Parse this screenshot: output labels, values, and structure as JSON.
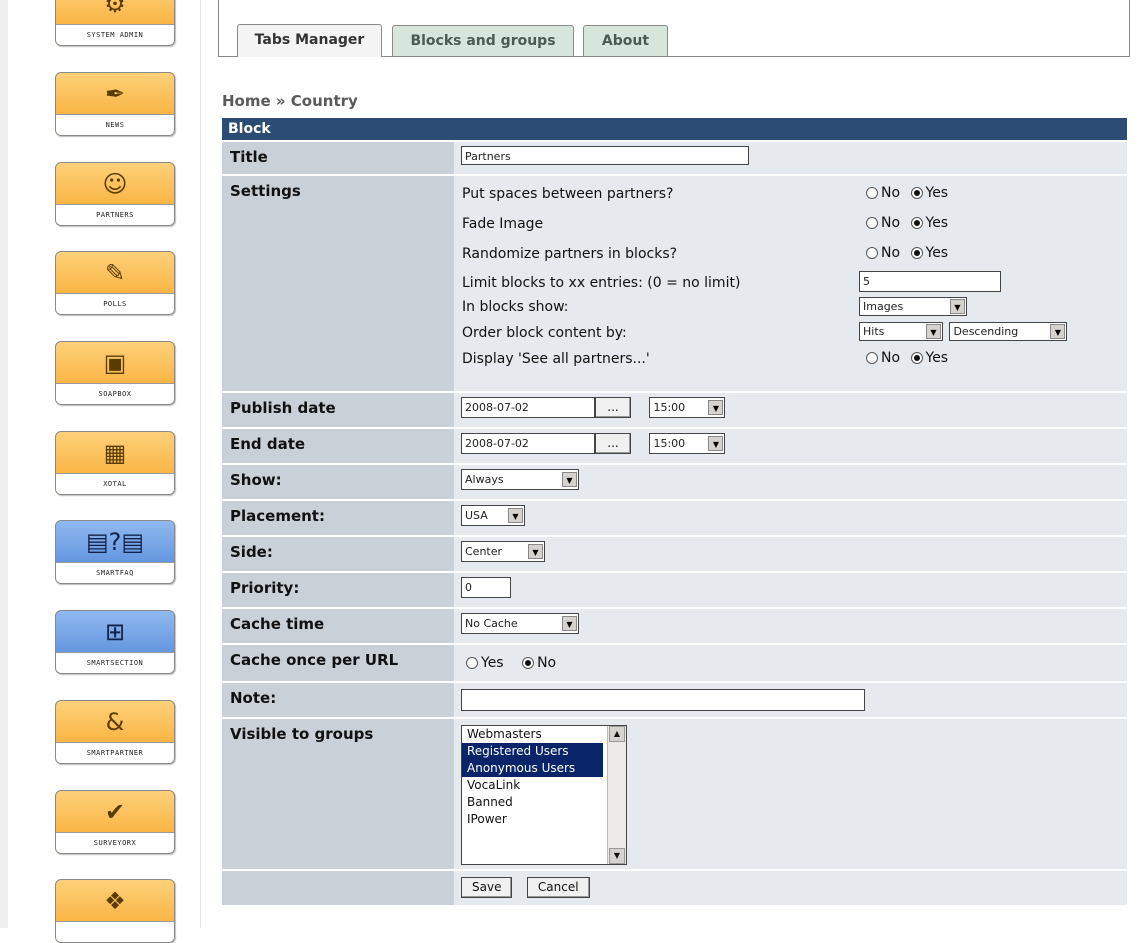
{
  "sidebar": {
    "modules": [
      {
        "label": "SYSTEM ADMIN",
        "icon": "system-admin-icon"
      },
      {
        "label": "NEWS",
        "icon": "news-icon"
      },
      {
        "label": "PARTNERS",
        "icon": "partners-icon"
      },
      {
        "label": "POLLS",
        "icon": "polls-icon"
      },
      {
        "label": "SOAPBOX",
        "icon": "soapbox-icon"
      },
      {
        "label": "XOTAL",
        "icon": "xotal-icon"
      },
      {
        "label": "SMARTFAQ",
        "icon": "smartfaq-icon"
      },
      {
        "label": "SMARTSECTION",
        "icon": "smartsection-icon"
      },
      {
        "label": "SMARTPARTNER",
        "icon": "smartpartner-icon"
      },
      {
        "label": "SURVEYORX",
        "icon": "surveyorx-icon"
      },
      {
        "label": "",
        "icon": "module-icon"
      }
    ]
  },
  "tabs": [
    {
      "label": "Tabs Manager",
      "active": true
    },
    {
      "label": "Blocks and groups",
      "active": false
    },
    {
      "label": "About",
      "active": false
    }
  ],
  "breadcrumb": "Home » Country",
  "form": {
    "header": "Block",
    "title": {
      "label": "Title",
      "value": "Partners"
    },
    "settings": {
      "label": "Settings",
      "spaces": {
        "question": "Put spaces between partners?",
        "no": "No",
        "yes": "Yes",
        "selected": "yes"
      },
      "fade": {
        "question": "Fade Image",
        "no": "No",
        "yes": "Yes",
        "selected": "yes"
      },
      "randomize": {
        "question": "Randomize partners in blocks?",
        "no": "No",
        "yes": "Yes",
        "selected": "yes"
      },
      "limit": {
        "question": "Limit blocks to xx entries: (0 = no limit)",
        "value": "5"
      },
      "show": {
        "question": "In blocks show:",
        "value": "Images"
      },
      "order": {
        "question": "Order block content by:",
        "field": "Hits",
        "direction": "Descending"
      },
      "see_all": {
        "question": "Display 'See all partners...'",
        "no": "No",
        "yes": "Yes",
        "selected": "yes"
      }
    },
    "publish_date": {
      "label": "Publish date",
      "date": "2008-07-02",
      "picker": "...",
      "time": "15:00"
    },
    "end_date": {
      "label": "End date",
      "date": "2008-07-02",
      "picker": "...",
      "time": "15:00"
    },
    "show": {
      "label": "Show:",
      "value": "Always"
    },
    "placement": {
      "label": "Placement:",
      "value": "USA"
    },
    "side": {
      "label": "Side:",
      "value": "Center"
    },
    "priority": {
      "label": "Priority:",
      "value": "0"
    },
    "cache_time": {
      "label": "Cache time",
      "value": "No Cache"
    },
    "cache_url": {
      "label": "Cache once per URL",
      "yes": "Yes",
      "no": "No",
      "selected": "no"
    },
    "note": {
      "label": "Note:",
      "value": ""
    },
    "groups": {
      "label": "Visible to groups",
      "options": [
        {
          "name": "Webmasters",
          "selected": false
        },
        {
          "name": "Registered Users",
          "selected": true
        },
        {
          "name": "Anonymous Users",
          "selected": true
        },
        {
          "name": "VocaLink",
          "selected": false
        },
        {
          "name": "Banned",
          "selected": false
        },
        {
          "name": "IPower",
          "selected": false
        }
      ]
    },
    "save_label": "Save",
    "cancel_label": "Cancel"
  }
}
